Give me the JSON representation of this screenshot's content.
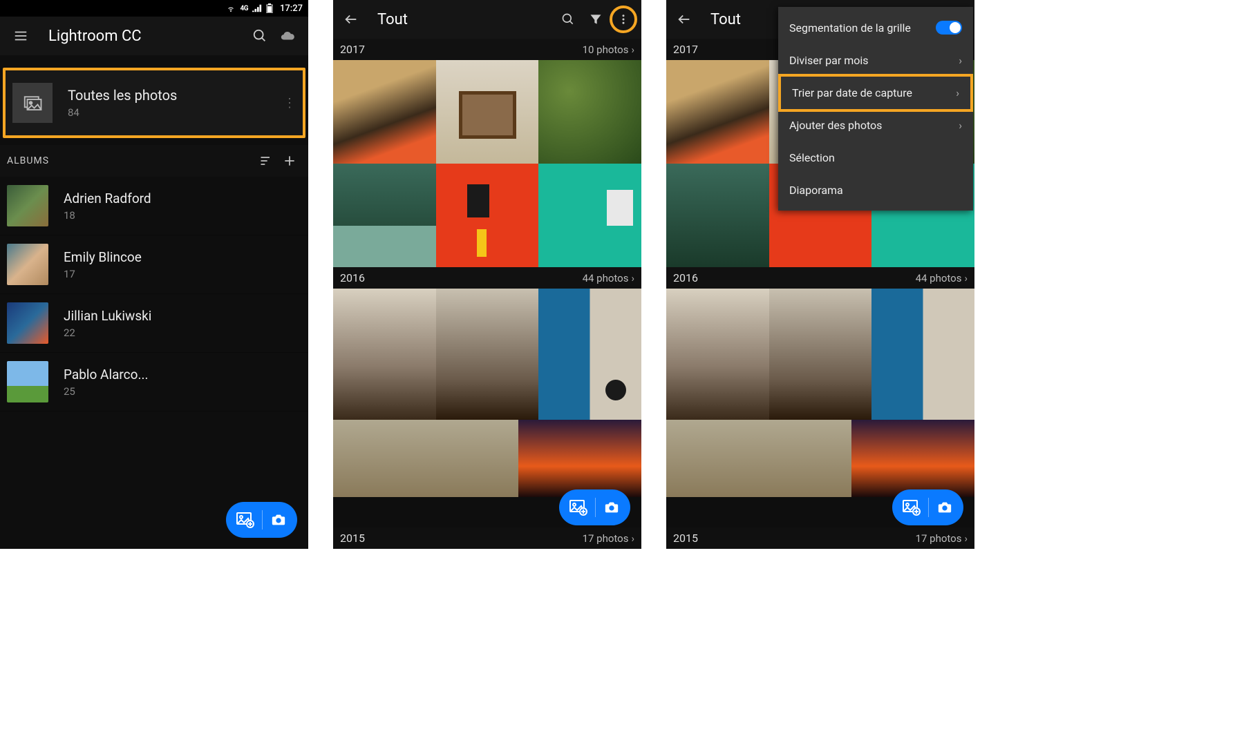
{
  "statusbar": {
    "time": "17:27",
    "network": "4G"
  },
  "screen1": {
    "title": "Lightroom CC",
    "allphotos": {
      "label": "Toutes les photos",
      "count": "84"
    },
    "albums_label": "ALBUMS",
    "albums": [
      {
        "name": "Adrien Radford",
        "count": "18"
      },
      {
        "name": "Emily Blincoe",
        "count": "17"
      },
      {
        "name": "Jillian Lukiwski",
        "count": "22"
      },
      {
        "name": "Pablo Alarco...",
        "count": "25"
      }
    ]
  },
  "screen2": {
    "title": "Tout",
    "sections": [
      {
        "year": "2017",
        "count": "10 photos"
      },
      {
        "year": "2016",
        "count": "44 photos"
      },
      {
        "year": "2015",
        "count": "17 photos"
      }
    ]
  },
  "screen3": {
    "title": "Tout",
    "sections": [
      {
        "year": "2017",
        "count": ""
      },
      {
        "year": "2016",
        "count": "44 photos"
      },
      {
        "year": "2015",
        "count": "17 photos"
      }
    ],
    "menu": {
      "segmentation": "Segmentation de la grille",
      "divide_month": "Diviser par mois",
      "sort_capture": "Trier par date de capture",
      "add_photos": "Ajouter des photos",
      "selection": "Sélection",
      "slideshow": "Diaporama"
    }
  }
}
